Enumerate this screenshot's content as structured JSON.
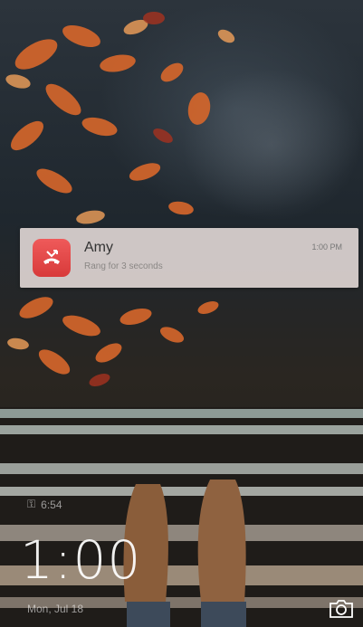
{
  "notification": {
    "title": "Amy",
    "subtitle": "Rang for 3 seconds",
    "time": "1:00 PM",
    "icon": "missed-call-icon",
    "icon_color": "#e44b4b"
  },
  "lockscreen": {
    "status_text": "6:54",
    "clock": "1:00",
    "date": "Mon, Jul 18"
  },
  "icons": {
    "camera": "camera-icon"
  }
}
